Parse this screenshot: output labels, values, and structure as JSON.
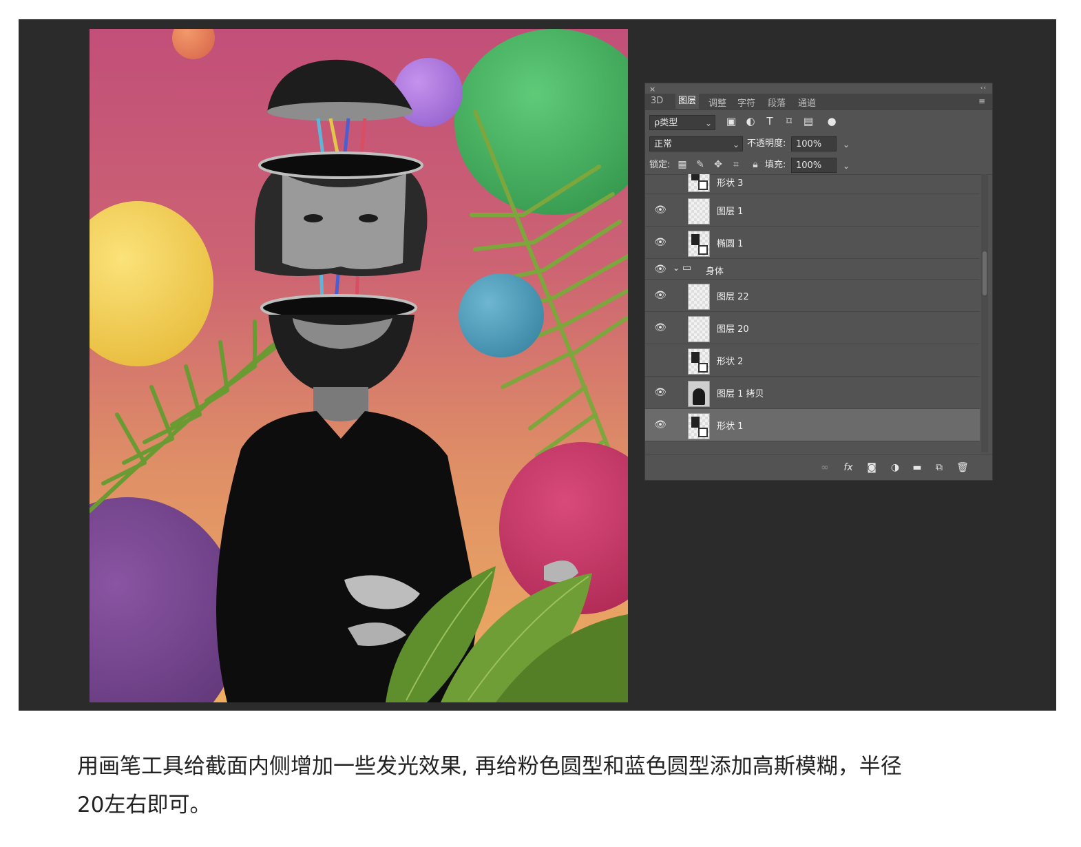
{
  "panel": {
    "close_icon": "×",
    "grip_icon": "‹‹",
    "tabs": [
      {
        "label": "3D",
        "active": false
      },
      {
        "label": "图层",
        "active": true
      },
      {
        "label": "调整",
        "active": false
      },
      {
        "label": "字符",
        "active": false
      },
      {
        "label": "段落",
        "active": false
      },
      {
        "label": "通道",
        "active": false
      }
    ],
    "menu_icon": "≡",
    "filter": {
      "label": "ρ类型"
    },
    "blend_mode": "正常",
    "opacity": {
      "label": "不透明度:",
      "value": "100%"
    },
    "lock": {
      "label": "锁定:"
    },
    "fill": {
      "label": "填充:",
      "value": "100%"
    },
    "layers": [
      {
        "name": "形状 3",
        "visible": false,
        "thumb": "shape",
        "selected": false
      },
      {
        "name": "图层 1",
        "visible": true,
        "thumb": "transparent",
        "selected": false
      },
      {
        "name": "椭圆 1",
        "visible": true,
        "thumb": "shape",
        "selected": false
      },
      {
        "name": "身体",
        "visible": true,
        "group": true,
        "selected": false
      },
      {
        "name": "图层 22",
        "visible": true,
        "thumb": "transparent",
        "selected": false
      },
      {
        "name": "图层 20",
        "visible": true,
        "thumb": "transparent",
        "selected": false
      },
      {
        "name": "形状 2",
        "visible": false,
        "thumb": "shape",
        "selected": false
      },
      {
        "name": "图层 1 拷贝",
        "visible": true,
        "thumb": "photo",
        "selected": false
      },
      {
        "name": "形状 1",
        "visible": true,
        "thumb": "shape",
        "selected": true
      }
    ]
  },
  "icons": {
    "eye": "eye-icon",
    "link": "link-icon",
    "fx": "fx",
    "mask": "mask-icon",
    "adjust": "adjustment-icon",
    "folder": "folder-icon",
    "new": "new-layer-icon",
    "trash": "trash-icon"
  },
  "caption": {
    "line1": "用画笔工具给截面内侧增加一些发光效果, 再给粉色圆型和蓝色圆型添加高斯模糊，半径",
    "line2": "20左右即可。"
  }
}
